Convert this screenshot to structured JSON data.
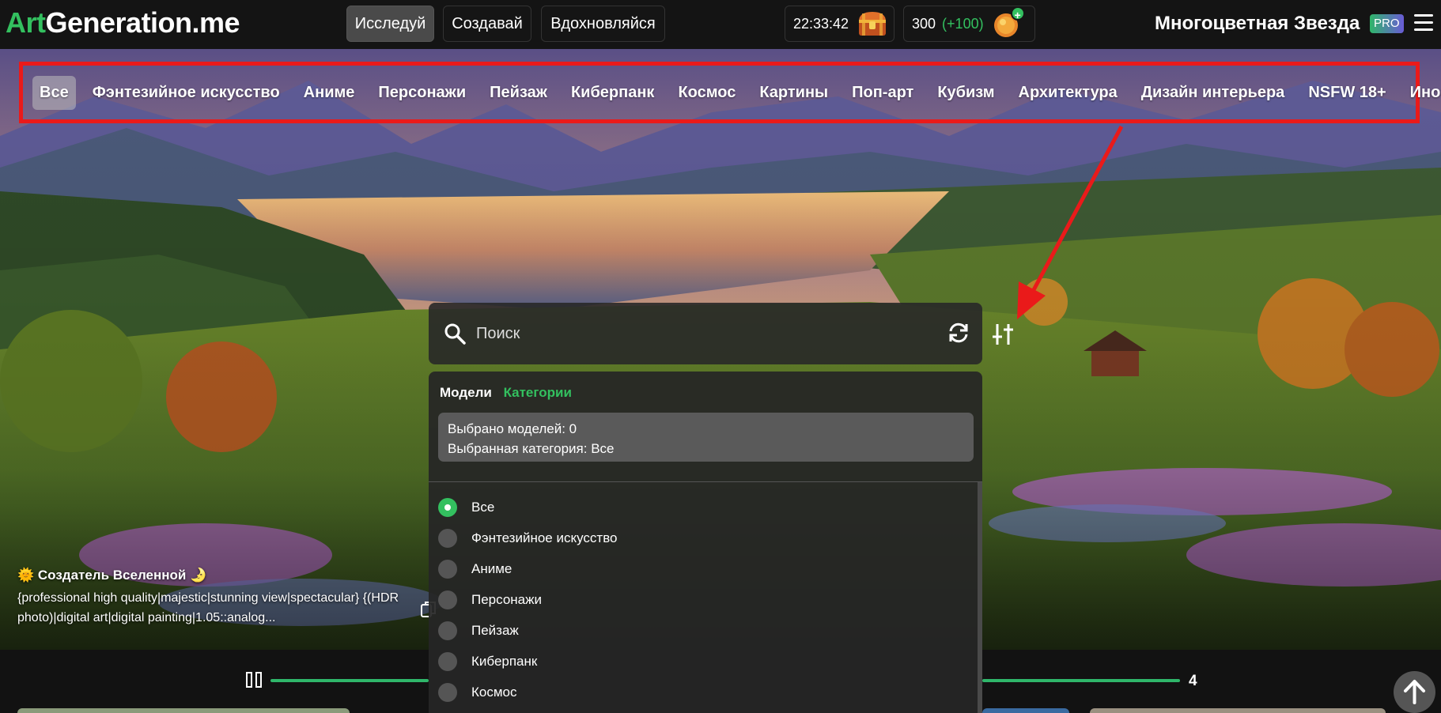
{
  "header": {
    "logo_accent": "Art",
    "logo_rest": "Generation.me",
    "nav": [
      "Исследуй",
      "Создавай",
      "Вдохновляйся"
    ],
    "time": "22:33:42",
    "credits": "300",
    "credits_bonus": "(+100)",
    "user_name": "Многоцветная Звезда",
    "badge": "PRO"
  },
  "categories": [
    "Все",
    "Фэнтезийное искусство",
    "Аниме",
    "Персонажи",
    "Пейзаж",
    "Киберпанк",
    "Космос",
    "Картины",
    "Поп-арт",
    "Кубизм",
    "Архитектура",
    "Дизайн интерьера",
    "NSFW 18+",
    "Иное"
  ],
  "search": {
    "placeholder": "Поиск"
  },
  "panel": {
    "tab_models": "Модели",
    "tab_categories": "Категории",
    "selected_models": "Выбрано моделей: 0",
    "selected_category": "Выбранная категория: Все",
    "options": [
      "Все",
      "Фэнтезийное искусство",
      "Аниме",
      "Персонажи",
      "Пейзаж",
      "Киберпанк",
      "Космос"
    ]
  },
  "creator": {
    "name": "🌞 Создатель Вселенной 🌛",
    "prompt": "{professional high quality|majestic|stunning view|spectacular} {(HDR photo)|digital art|digital painting|1.05::analog..."
  },
  "slider": {
    "page": "4"
  },
  "colors": {
    "accent_green": "#33c05f",
    "highlight_red": "#ea1a1a",
    "header_bg": "#141414"
  }
}
